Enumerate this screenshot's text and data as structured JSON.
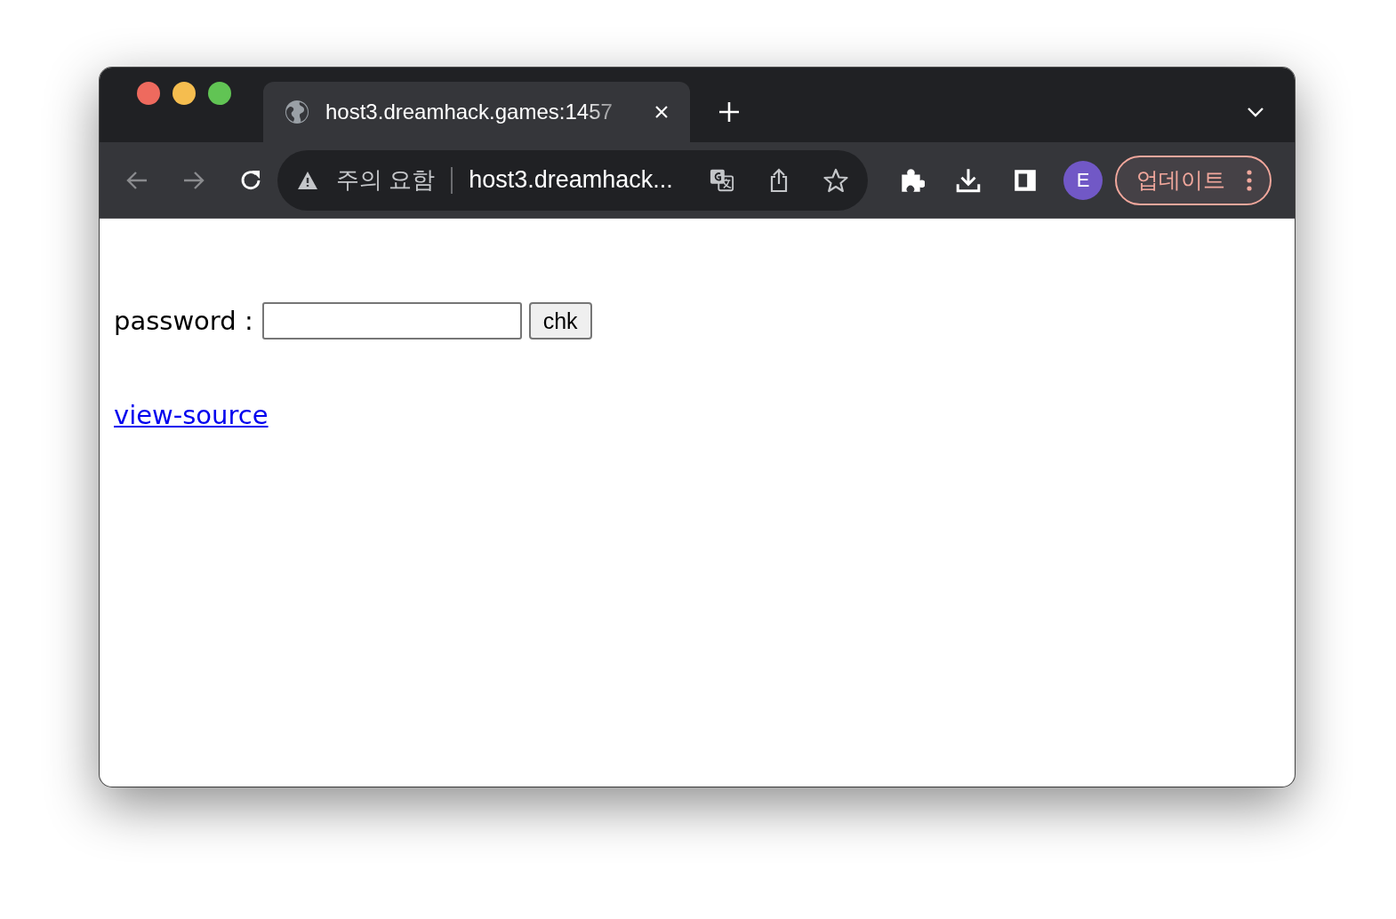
{
  "tab": {
    "title": "host3.dreamhack.games:1457",
    "selected": true
  },
  "address_bar": {
    "security_label": "주의 요함",
    "url": "host3.dreamhack..."
  },
  "toolbar": {
    "avatar": "E",
    "update_button": "업데이트"
  },
  "page": {
    "label": "password :",
    "button": "chk",
    "link": "view-source"
  }
}
